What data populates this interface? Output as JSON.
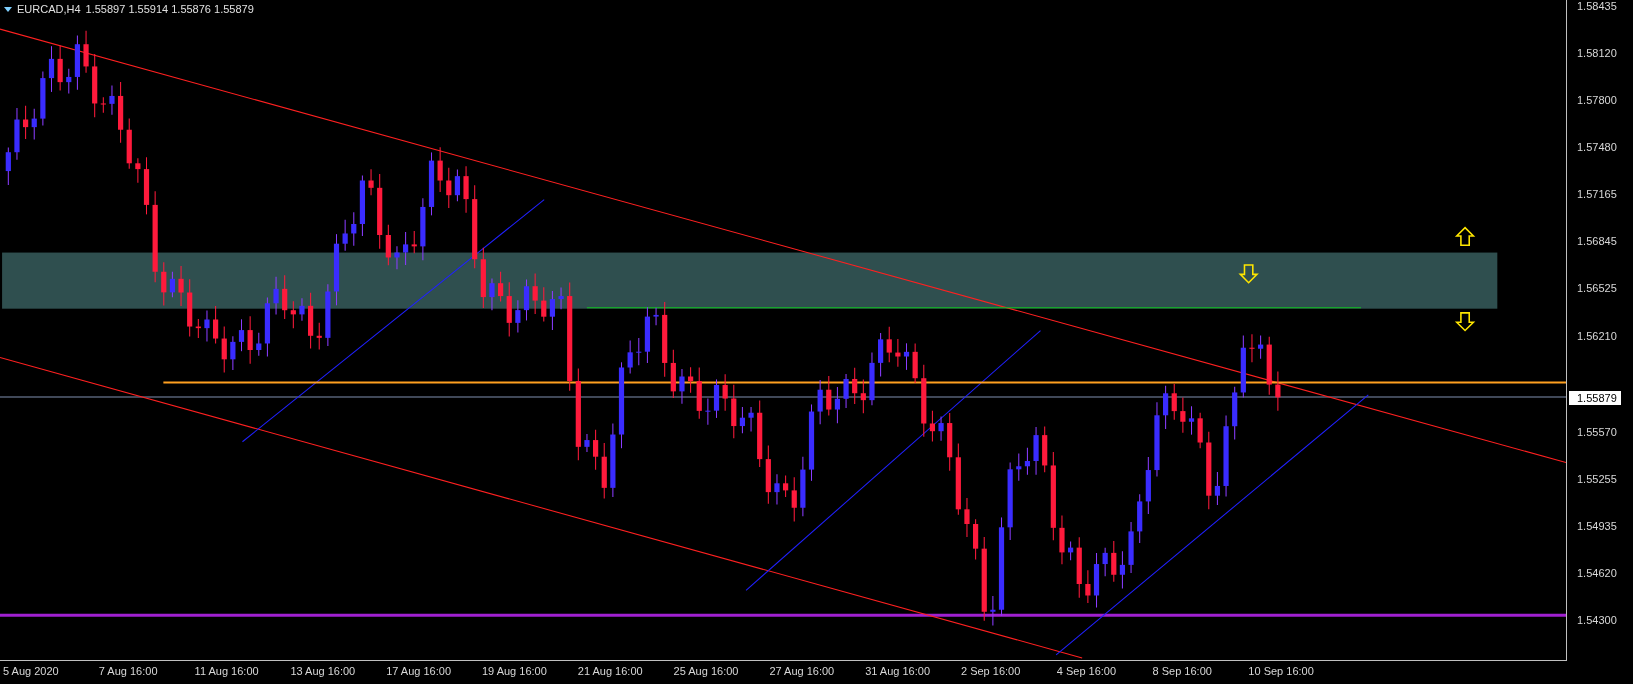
{
  "header": {
    "symbol": "EURCAD,H4",
    "quote": "1.55897 1.55914 1.55876 1.55879"
  },
  "price_axis": [
    "1.58435",
    "1.58120",
    "1.57800",
    "1.57480",
    "1.57165",
    "1.56845",
    "1.56525",
    "1.56210",
    "1.55570",
    "1.55255",
    "1.54935",
    "1.54620",
    "1.54300"
  ],
  "current_price": "1.55879",
  "time_axis": [
    "5 Aug 2020",
    "7 Aug 16:00",
    "11 Aug 16:00",
    "13 Aug 16:00",
    "17 Aug 16:00",
    "19 Aug 16:00",
    "21 Aug 16:00",
    "25 Aug 16:00",
    "27 Aug 16:00",
    "31 Aug 16:00",
    "2 Sep 16:00",
    "4 Sep 16:00",
    "8 Sep 16:00",
    "10 Sep 16:00"
  ]
}
